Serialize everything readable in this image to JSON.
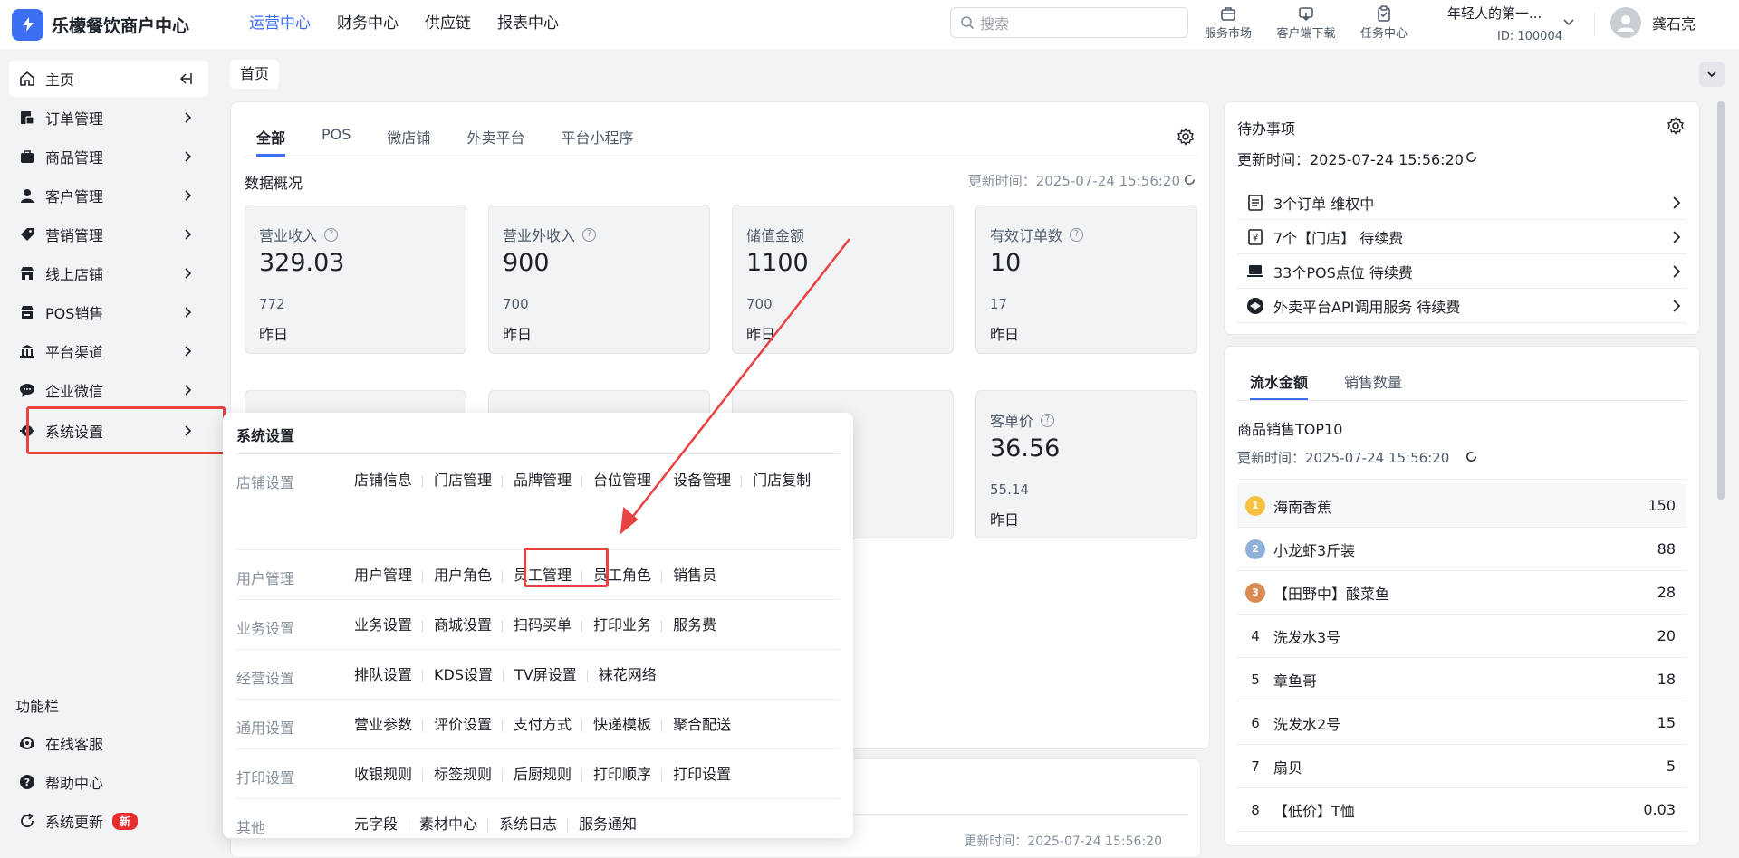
{
  "app": {
    "title": "乐檬餐饮商户中心",
    "logo_glyph": "⚡"
  },
  "topnav": [
    {
      "label": "运营中心",
      "active": true
    },
    {
      "label": "财务中心"
    },
    {
      "label": "供应链"
    },
    {
      "label": "报表中心"
    }
  ],
  "search": {
    "placeholder": "搜索"
  },
  "toolbar": {
    "market": "服务市场",
    "client": "客户端下载",
    "task": "任务中心"
  },
  "org": {
    "name": "年轻人的第一...",
    "id": "ID: 100004"
  },
  "user": {
    "name": "龚石亮"
  },
  "sidebar": {
    "items": [
      {
        "label": "主页"
      },
      {
        "label": "订单管理"
      },
      {
        "label": "商品管理"
      },
      {
        "label": "客户管理"
      },
      {
        "label": "营销管理"
      },
      {
        "label": "线上店铺"
      },
      {
        "label": "POS销售"
      },
      {
        "label": "平台渠道"
      },
      {
        "label": "企业微信"
      },
      {
        "label": "系统设置"
      }
    ],
    "func_title": "功能栏",
    "func_items": [
      {
        "label": "在线客服"
      },
      {
        "label": "帮助中心"
      },
      {
        "label": "系统更新",
        "badge": "新"
      }
    ]
  },
  "breadcrumb": {
    "label": "首页"
  },
  "overview": {
    "tabs": [
      "全部",
      "POS",
      "微店铺",
      "外卖平台",
      "平台小程序"
    ],
    "title": "数据概况",
    "updated": "更新时间：2025-07-24 15:56:20",
    "stats": [
      {
        "label": "营业收入",
        "value": "329.03",
        "sub": "772",
        "sub_label": "昨日"
      },
      {
        "label": "营业外收入",
        "value": "900",
        "sub": "700",
        "sub_label": "昨日"
      },
      {
        "label": "储值金额",
        "value": "1100",
        "sub": "700",
        "sub_label": "昨日"
      },
      {
        "label": "有效订单数",
        "value": "10",
        "sub": "17",
        "sub_label": "昨日"
      },
      {
        "label": "客单价",
        "value": "36.56",
        "sub": "55.14",
        "sub_label": "昨日"
      }
    ]
  },
  "bottom": {
    "updated": "更新时间：2025-07-24 15:56:20"
  },
  "todo": {
    "title": "待办事项",
    "updated": "更新时间：2025-07-24 15:56:20",
    "items": [
      {
        "text": "3个订单 维权中"
      },
      {
        "text": "7个【门店】 待续费"
      },
      {
        "text": "33个POS点位 待续费"
      },
      {
        "text": "外卖平台API调用服务 待续费"
      }
    ]
  },
  "sales": {
    "tabs": [
      "流水金额",
      "销售数量"
    ],
    "title": "商品销售TOP10",
    "updated": "更新时间：2025-07-24 15:56:20",
    "rows": [
      {
        "rank": "1",
        "name": "海南香蕉",
        "value": "150"
      },
      {
        "rank": "2",
        "name": "小龙虾3斤装",
        "value": "88"
      },
      {
        "rank": "3",
        "name": "【田野中】酸菜鱼",
        "value": "28"
      },
      {
        "rank": "4",
        "name": "洗发水3号",
        "value": "20"
      },
      {
        "rank": "5",
        "name": "章鱼哥",
        "value": "18"
      },
      {
        "rank": "6",
        "name": "洗发水2号",
        "value": "15"
      },
      {
        "rank": "7",
        "name": "扇贝",
        "value": "5"
      },
      {
        "rank": "8",
        "name": "【低价】T恤",
        "value": "0.03"
      }
    ]
  },
  "menu": {
    "title": "系统设置",
    "groups": [
      {
        "label": "店铺设置",
        "items": [
          "店铺信息",
          "门店管理",
          "品牌管理",
          "台位管理",
          "设备管理",
          "门店复制"
        ]
      },
      {
        "label": "用户管理",
        "items": [
          "用户管理",
          "用户角色",
          "员工管理",
          "员工角色",
          "销售员"
        ]
      },
      {
        "label": "业务设置",
        "items": [
          "业务设置",
          "商城设置",
          "扫码买单",
          "打印业务",
          "服务费"
        ]
      },
      {
        "label": "经营设置",
        "items": [
          "排队设置",
          "KDS设置",
          "TV屏设置",
          "袜花网络"
        ]
      },
      {
        "label": "通用设置",
        "items": [
          "营业参数",
          "评价设置",
          "支付方式",
          "快递模板",
          "聚合配送"
        ]
      },
      {
        "label": "打印设置",
        "items": [
          "收银规则",
          "标签规则",
          "后厨规则",
          "打印顺序",
          "打印设置"
        ]
      },
      {
        "label": "其他",
        "items": [
          "元字段",
          "素材中心",
          "系统日志",
          "服务通知"
        ]
      }
    ]
  },
  "colors": {
    "accent": "#3d6ff5",
    "highlight": "#e84242",
    "badge": "#e52e2e"
  }
}
